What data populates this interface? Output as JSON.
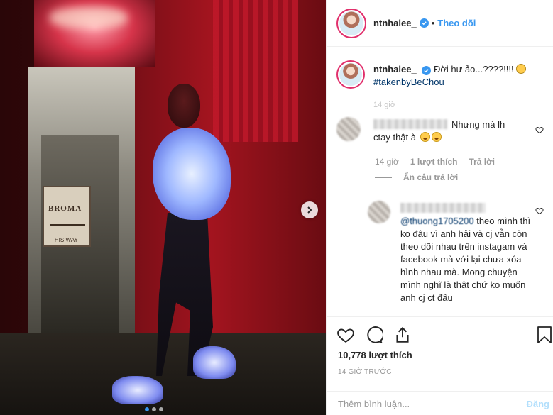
{
  "header": {
    "username": "ntnhalee_",
    "separator": "•",
    "follow_label": "Theo dõi"
  },
  "caption": {
    "username": "ntnhalee_",
    "text": "Đời hư ảo...????!!!!",
    "hashtag": "#takenbyBeChou",
    "time": "14 giờ"
  },
  "comments": [
    {
      "text_line1": "Nhưng mà lh",
      "text_line2": "ctay thật à",
      "time": "14 giờ",
      "likes": "1 lượt thích",
      "reply_label": "Trả lời",
      "hide_replies_label": "Ẩn câu trả lời"
    },
    {
      "mention": "@thuong1705200",
      "text": "theo mình thì ko đâu vì anh hải và cj vẫn còn theo dõi nhau trên instagam và facebook mà với lại chưa xóa hình nhau mà. Mong chuyện mình nghĩ là thật chứ ko muốn anh cj ct đâu"
    }
  ],
  "actions": {
    "likes_count": "10,778",
    "likes_label": "lượt thích",
    "timestamp": "14 GIỜ TRƯỚC",
    "comment_placeholder": "Thêm bình luận...",
    "post_label": "Đăng"
  },
  "photo": {
    "sign_text": "BROMA",
    "sign_subtext": "THIS WAY",
    "carousel_dots": 3,
    "carousel_active_index": 0
  },
  "colors": {
    "link_blue": "#3897f0",
    "hashtag_blue": "#003569",
    "muted": "#999999",
    "post_disabled": "#b2dffc"
  },
  "icons": [
    "verified-icon",
    "chevron-right-icon",
    "heart-icon",
    "comment-icon",
    "share-icon",
    "bookmark-icon",
    "laughing-emoji-icon",
    "person-emoji-icon"
  ]
}
